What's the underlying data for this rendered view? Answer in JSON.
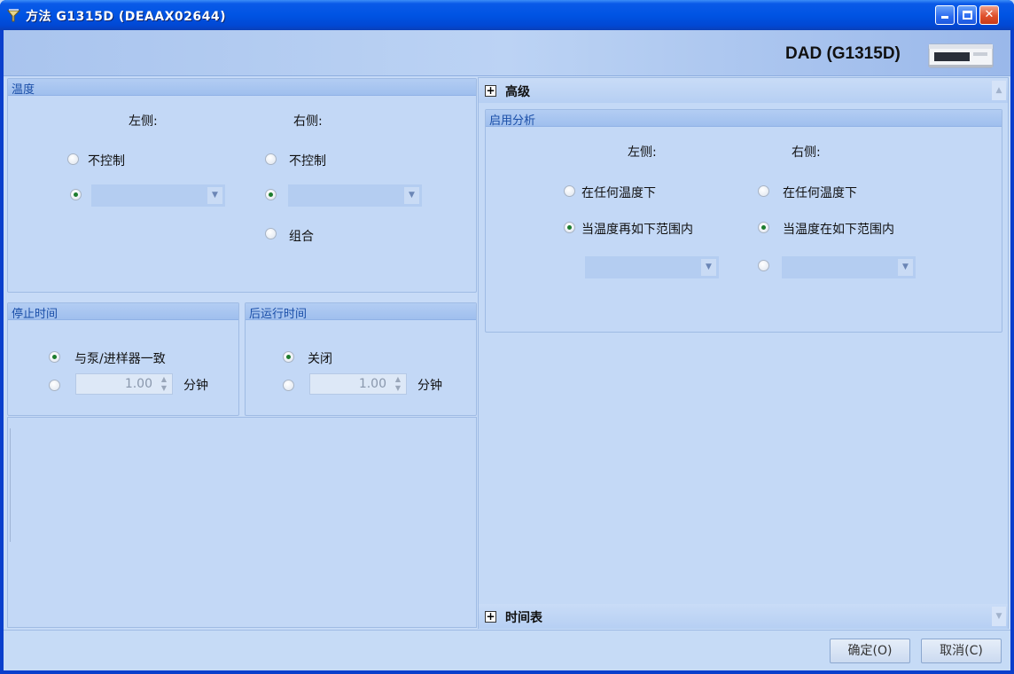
{
  "window": {
    "title": "方法 G1315D (DEAAX02644)",
    "controls": {
      "minimize": "_",
      "maximize": "□",
      "close": "✕"
    }
  },
  "header": {
    "module_name": "DAD (G1315D)"
  },
  "temperature": {
    "title": "温度",
    "left_label": "左侧:",
    "right_label": "右侧:",
    "no_control": "不控制",
    "combined": "组合",
    "left_selected": "value",
    "right_selected": "value"
  },
  "stop_time": {
    "title": "停止时间",
    "option_sync": "与泵/进样器一致",
    "value": "1.00",
    "unit": "分钟",
    "selected": "sync"
  },
  "post_time": {
    "title": "后运行时间",
    "option_off": "关闭",
    "value": "1.00",
    "unit": "分钟",
    "selected": "off"
  },
  "advanced": {
    "title": "高级",
    "enable_analysis": {
      "title": "启用分析",
      "left_label": "左侧:",
      "right_label": "右侧:",
      "any_temp": "在任何温度下",
      "left_in_range": "当温度再如下范围内",
      "right_in_range": "当温度在如下范围内",
      "left_selected": "in_range",
      "right_selected": "in_range"
    }
  },
  "timetable": {
    "title": "时间表"
  },
  "footer": {
    "ok": "确定(O)",
    "cancel": "取消(C)"
  },
  "colors": {
    "titlebar": "#0054e3",
    "client_bg": "#c7dbf7",
    "group_header_text": "#1a4ea8",
    "radio_dot": "#1d7d2d"
  },
  "icons": {
    "title_icon": "method-icon",
    "device_icon": "dad-module-icon"
  }
}
